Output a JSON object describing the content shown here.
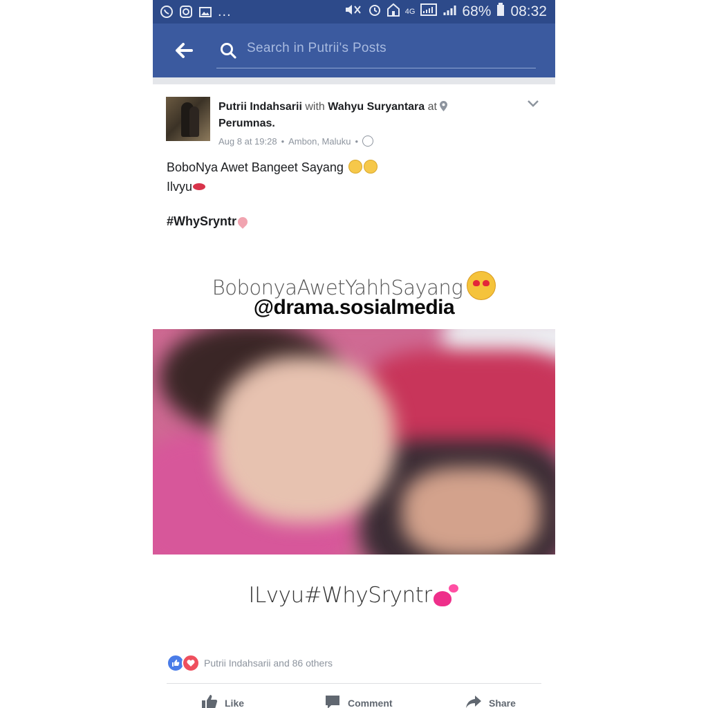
{
  "status_bar": {
    "left_icons": [
      "whatsapp-icon",
      "instagram-icon",
      "gallery-icon"
    ],
    "more": "...",
    "network": "4G",
    "battery": "68%",
    "time": "08:32"
  },
  "header": {
    "search_placeholder": "Search in Putrii's Posts"
  },
  "post": {
    "author": "Putrii Indahsarii",
    "with_word": "with",
    "tagged": "Wahyu Suryantara",
    "at_word": "at",
    "place": "Perumnas.",
    "timestamp": "Aug 8 at 19:28",
    "dot": "•",
    "location": "Ambon, Maluku",
    "line1": "BoboNya Awet Bangeet Sayang",
    "line2": "Ilvyu",
    "hashtag": "#WhySryntr",
    "image_caption_top": "BobonyaAwetYahhSayang",
    "watermark": "@drama.sosialmedia",
    "image_caption_bottom": "ILvyu#WhySryntr"
  },
  "reactions": {
    "text": "Putrii Indahsarii and 86 others"
  },
  "actions": {
    "like": "Like",
    "comment": "Comment",
    "share": "Share"
  },
  "colors": {
    "status_bar": "#2d4a8a",
    "header": "#3b5a9f"
  }
}
